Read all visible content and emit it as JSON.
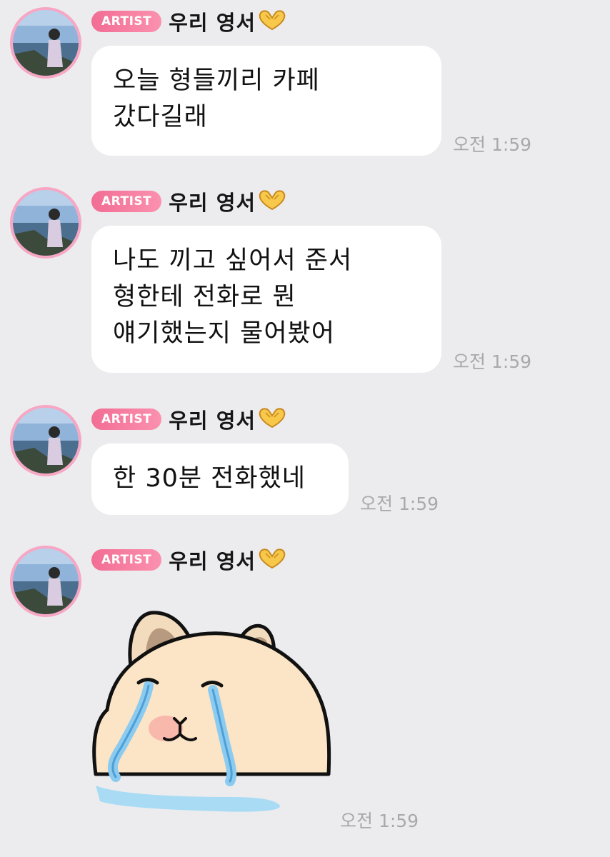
{
  "colors": {
    "background": "#ececee",
    "badge": "#f57a9c",
    "avatar_ring": "#f7a6c4",
    "bubble": "#ffffff",
    "time": "#a9a9a9"
  },
  "messages": [
    {
      "badge": "ARTIST",
      "sender": "우리 영서",
      "sender_emoji": "heart-hands-icon",
      "lines": [
        "오늘 형들끼리 카페",
        "갔다길래"
      ],
      "time": "오전 1:59"
    },
    {
      "badge": "ARTIST",
      "sender": "우리 영서",
      "sender_emoji": "heart-hands-icon",
      "lines": [
        "나도 끼고 싶어서 준서",
        "형한테 전화로 뭔",
        "얘기했는지 물어봤어"
      ],
      "time": "오전 1:59"
    },
    {
      "badge": "ARTIST",
      "sender": "우리 영서",
      "sender_emoji": "heart-hands-icon",
      "lines": [
        "한 30분 전화했네"
      ],
      "time": "오전 1:59"
    },
    {
      "badge": "ARTIST",
      "sender": "우리 영서",
      "sender_emoji": "heart-hands-icon",
      "sticker": "crying-capybara-sticker",
      "time": "오전 1:59"
    }
  ]
}
